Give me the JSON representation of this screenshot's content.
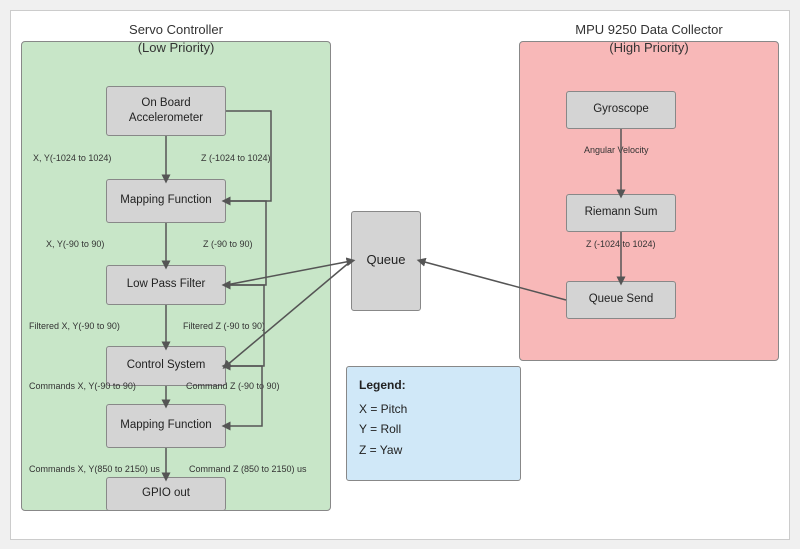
{
  "diagram": {
    "title_left": "Servo Controller\n(Low Priority)",
    "title_right": "MPU 9250 Data Collector\n(High Priority)",
    "blocks": {
      "accelerometer": "On Board\nAccelerometer",
      "mapping_function_1": "Mapping Function",
      "low_pass_filter": "Low Pass Filter",
      "control_system": "Control System",
      "mapping_function_2": "Mapping Function",
      "gpio_out": "GPIO out",
      "queue": "Queue",
      "gyroscope": "Gyroscope",
      "riemann_sum": "Riemann Sum",
      "queue_send": "Queue Send"
    },
    "labels": {
      "xy_1024": "X, Y(-1024 to 1024)",
      "z_1024": "Z (-1024 to 1024)",
      "xy_90": "X, Y(-90 to 90)",
      "z_90": "Z (-90 to 90)",
      "filtered_xy": "Filtered X, Y(-90 to 90)",
      "filtered_z": "Filtered Z (-90 to 90)",
      "commands_xy_90": "Commands X, Y(-90 to 90)",
      "command_z_90": "Command Z (-90 to 90)",
      "commands_xy_us": "Commands X, Y(850 to 2150) us",
      "command_z_us": "Command Z (850 to 2150) us",
      "angular_velocity": "Angular Velocity",
      "z_riemann": "Z (-1024 to 1024)"
    },
    "legend": {
      "title": "Legend:",
      "x": "X = Pitch",
      "y": "Y = Roll",
      "z": "Z = Yaw"
    }
  }
}
